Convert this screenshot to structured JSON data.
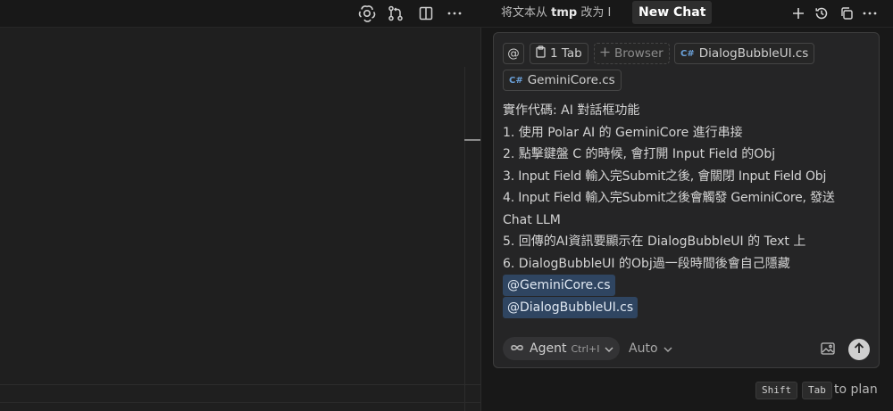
{
  "toolbar": {
    "icons": [
      "openai-icon",
      "source-control-icon",
      "split-editor-icon",
      "more-icon"
    ]
  },
  "chat_header": {
    "history_tab_prefix": "将文本从 ",
    "history_tab_bold": "tmp",
    "history_tab_suffix": " 改为 I",
    "new_chat_label": "New Chat",
    "action_icons": [
      "plus-icon",
      "history-icon",
      "copy-window-icon",
      "more-icon"
    ]
  },
  "context_chips": {
    "at_symbol": "@",
    "tab_chip": "1 Tab",
    "browser_chip": "Browser",
    "file_chip_1": "DialogBubbleUI.cs",
    "file_chip_2": "GeminiCore.cs",
    "cs_badge": "C#"
  },
  "prompt": {
    "line_0": "實作代碼: AI 對話框功能",
    "line_1": "1. 使用 Polar AI 的 GeminiCore 進行串接",
    "line_2": "2. 點擊鍵盤 C 的時候, 會打開 Input Field 的Obj",
    "line_3": "3. Input Field 輸入完Submit之後, 會關閉 Input Field Obj",
    "line_4": "4. Input Field 輸入完Submit之後會觸發 GeminiCore, 發送",
    "line_5": "Chat LLM",
    "line_6": "5. 回傳的AI資訊要顯示在 DialogBubbleUI 的 Text 上",
    "line_7": "6. DialogBubbleUI 的Obj過一段時間後會自己隱藏",
    "mention_1": "@GeminiCore.cs",
    "mention_2": "@DialogBubbleUI.cs"
  },
  "composer": {
    "mode_label": "Agent",
    "mode_shortcut": "Ctrl+I",
    "model_label": "Auto"
  },
  "hint": {
    "key_1": "Shift",
    "key_2": "Tab",
    "text": "to plan"
  }
}
